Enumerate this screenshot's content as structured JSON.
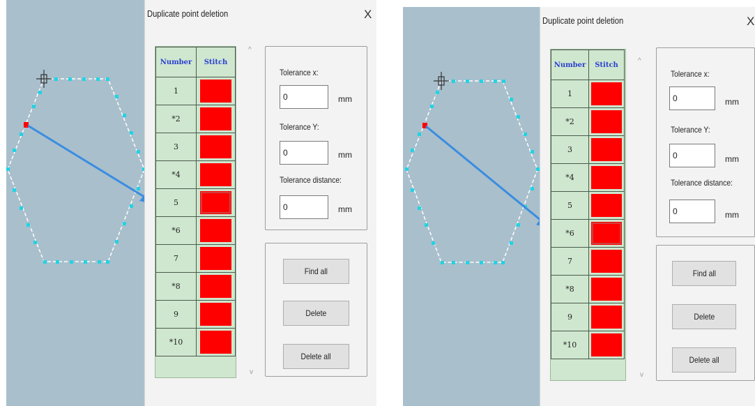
{
  "dialog": {
    "title": "Duplicate point deletion",
    "close_label": "X",
    "table_headers": [
      "Number",
      "Stitch"
    ],
    "rows": [
      {
        "number": "1",
        "stitch_color": "#ff0000"
      },
      {
        "number": "*2",
        "stitch_color": "#ff0000"
      },
      {
        "number": "3",
        "stitch_color": "#ff0000"
      },
      {
        "number": "*4",
        "stitch_color": "#ff0000"
      },
      {
        "number": "5",
        "stitch_color": "#ff0000"
      },
      {
        "number": "*6",
        "stitch_color": "#ff0000"
      },
      {
        "number": "7",
        "stitch_color": "#ff0000"
      },
      {
        "number": "*8",
        "stitch_color": "#ff0000"
      },
      {
        "number": "9",
        "stitch_color": "#ff0000"
      },
      {
        "number": "*10",
        "stitch_color": "#ff0000"
      }
    ],
    "tolerance_x_label": "Tolerance x:",
    "tolerance_x_value": "0",
    "tolerance_y_label": "Tolerance Y:",
    "tolerance_y_value": "0",
    "tolerance_distance_label": "Tolerance distance:",
    "tolerance_distance_value": "0",
    "unit": "mm",
    "find_all_label": "Find all",
    "delete_label": "Delete",
    "delete_all_label": "Delete all"
  },
  "left_panel": {
    "selected_row": "5"
  },
  "right_panel": {
    "selected_row": "*6"
  },
  "colors": {
    "canvas_bg": "#a9bfcc",
    "grid_bg": "#cfe7cf",
    "stitch_red": "#ff0000",
    "point_cyan": "#22d3e3",
    "arrow_blue": "#3a8de0"
  },
  "icons": [
    "cursor-crosshair-icon",
    "scroll-up-icon",
    "scroll-down-icon",
    "close-icon"
  ]
}
